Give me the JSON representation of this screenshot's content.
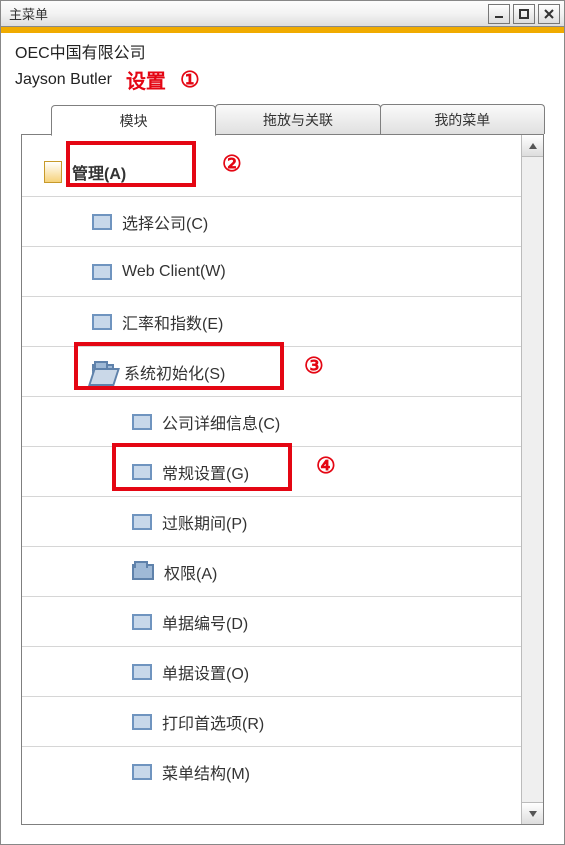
{
  "window": {
    "title": "主菜单"
  },
  "header": {
    "company": "OEC中国有限公司",
    "user": "Jayson Butler",
    "settings_label": "设置"
  },
  "tabs": {
    "t1": "模块",
    "t2": "拖放与关联",
    "t3": "我的菜单"
  },
  "tree": {
    "root": "管理(A)",
    "a1": "选择公司(C)",
    "a2": "Web Client(W)",
    "a3": "汇率和指数(E)",
    "a4": "系统初始化(S)",
    "b1": "公司详细信息(C)",
    "b2": "常规设置(G)",
    "b3": "过账期间(P)",
    "b4": "权限(A)",
    "b5": "单据编号(D)",
    "b6": "单据设置(O)",
    "b7": "打印首选项(R)",
    "b8": "菜单结构(M)"
  },
  "annotations": {
    "n1": "①",
    "n2": "②",
    "n3": "③",
    "n4": "④"
  }
}
